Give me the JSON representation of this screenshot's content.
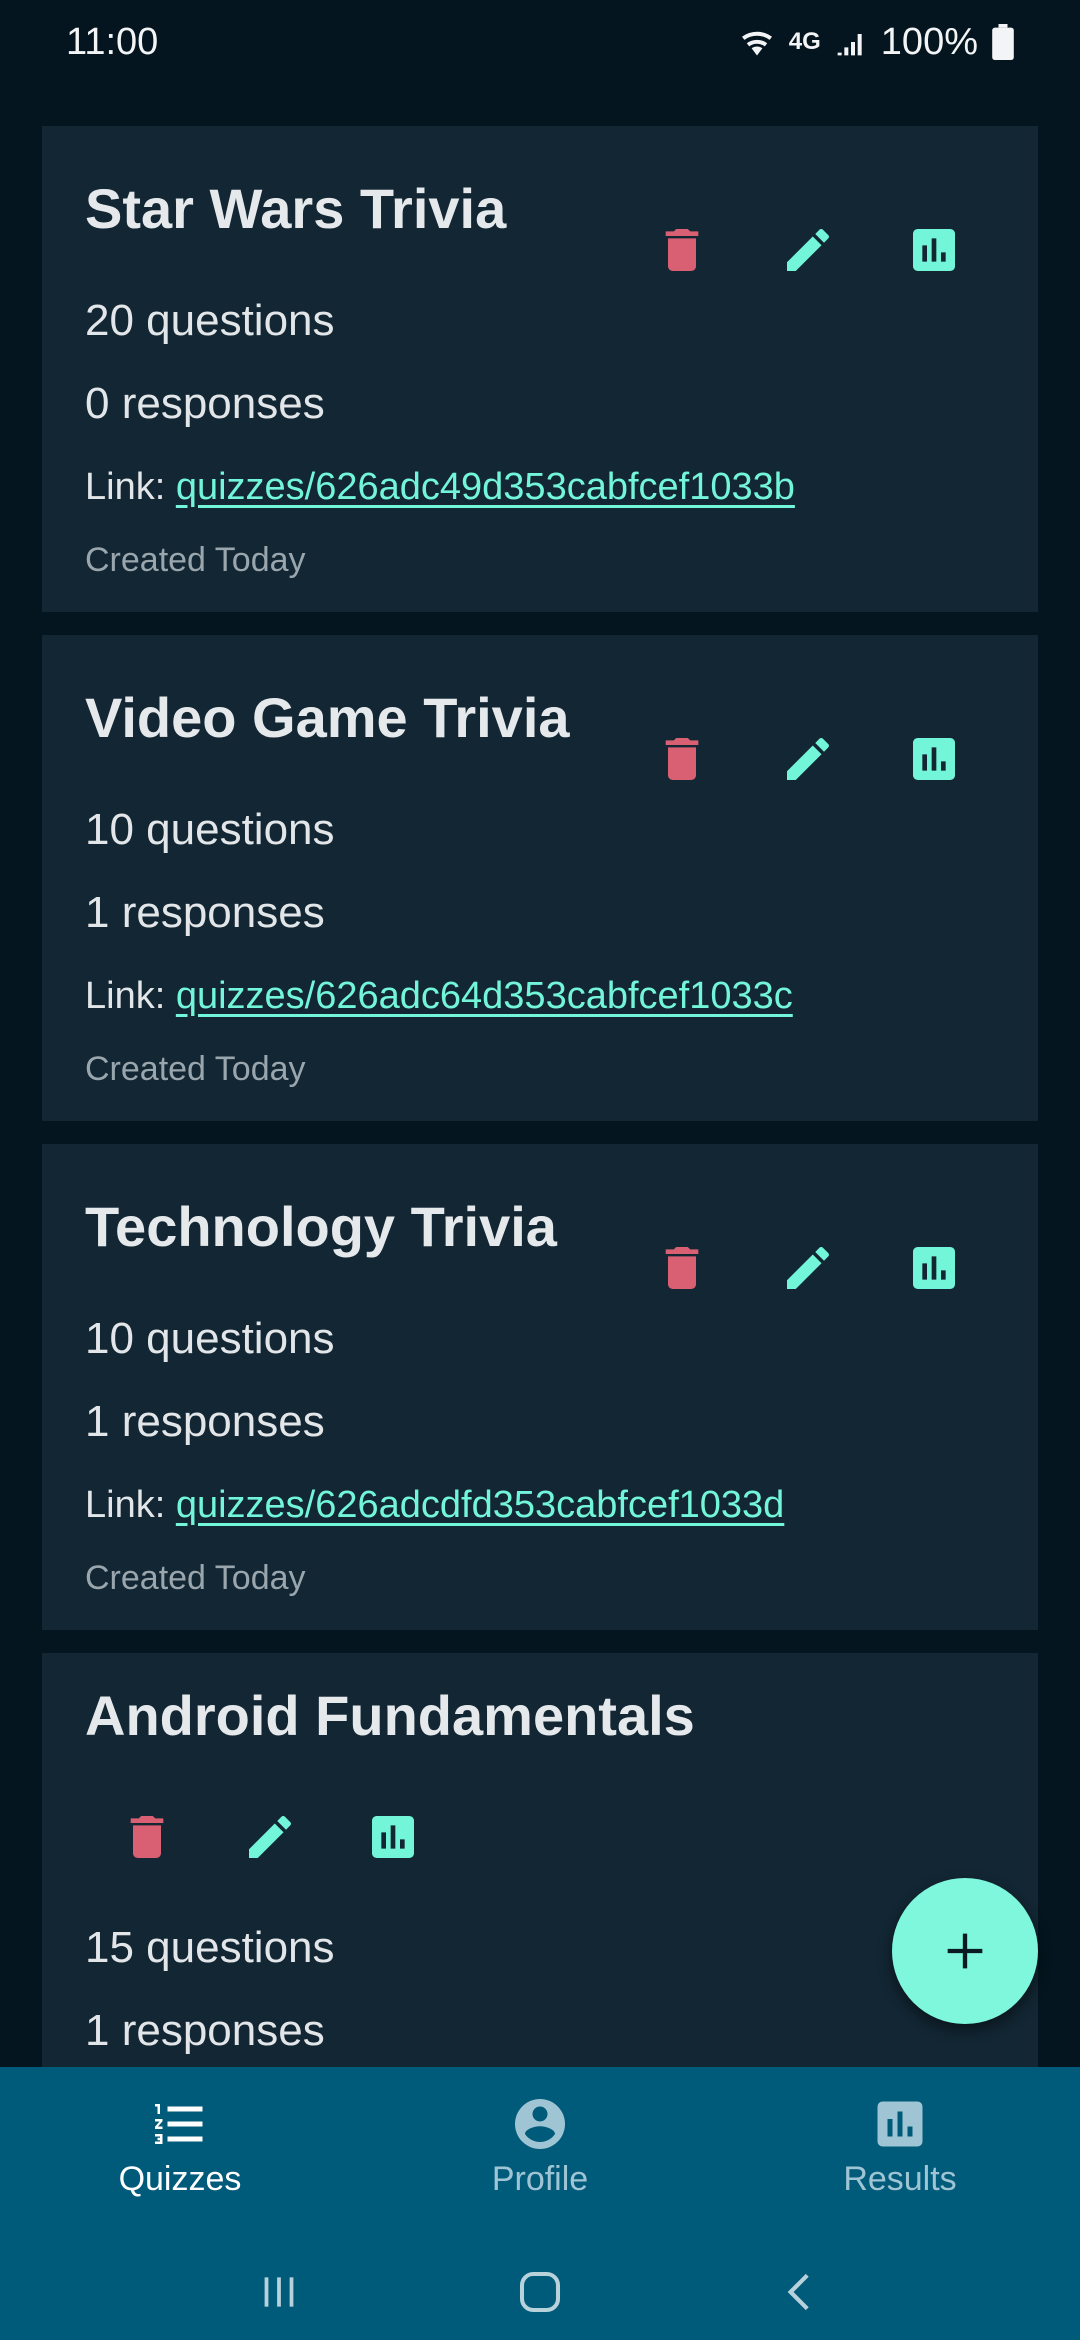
{
  "status_bar": {
    "time": "11:00",
    "network": "4G",
    "battery": "100%"
  },
  "quizzes": [
    {
      "title": "Star Wars Trivia",
      "questions": "20 questions",
      "responses": "0 responses",
      "link_label": "Link: ",
      "link": "quizzes/626adc49d353cabfcef1033b",
      "created": "Created Today"
    },
    {
      "title": "Video Game Trivia",
      "questions": "10 questions",
      "responses": "1 responses",
      "link_label": "Link: ",
      "link": "quizzes/626adc64d353cabfcef1033c",
      "created": "Created Today"
    },
    {
      "title": "Technology Trivia",
      "questions": "10 questions",
      "responses": "1 responses",
      "link_label": "Link: ",
      "link": "quizzes/626adcdfd353cabfcef1033d",
      "created": "Created Today"
    },
    {
      "title": "Android Fundamentals",
      "questions": "15 questions",
      "responses": "1 responses"
    }
  ],
  "bottom_nav": [
    {
      "label": "Quizzes",
      "icon": "list-numbered-icon"
    },
    {
      "label": "Profile",
      "icon": "account-circle-icon"
    },
    {
      "label": "Results",
      "icon": "bar-chart-icon"
    }
  ],
  "colors": {
    "background": "#04151f",
    "card": "#122633",
    "accent": "#72f5d8",
    "delete": "#d95f73",
    "nav": "#005a7a"
  }
}
